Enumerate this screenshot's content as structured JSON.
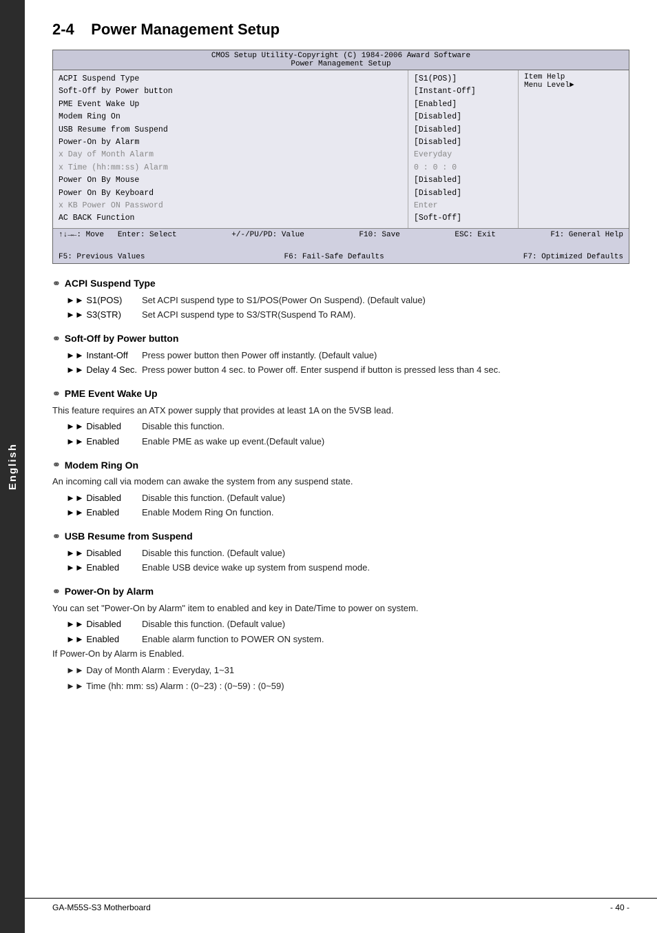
{
  "sidebar": {
    "label": "English"
  },
  "page": {
    "section": "2-4",
    "title": "Power Management Setup"
  },
  "bios": {
    "header1": "CMOS Setup Utility-Copyright (C) 1984-2006 Award Software",
    "header2": "Power Management Setup",
    "rows": [
      {
        "label": "    ACPI Suspend Type",
        "value": "[S1(POS)]",
        "dimmed": false
      },
      {
        "label": "    Soft-Off by Power button",
        "value": "[Instant-Off]",
        "dimmed": false
      },
      {
        "label": "    PME Event Wake Up",
        "value": "[Enabled]",
        "dimmed": false
      },
      {
        "label": "    Modem Ring On",
        "value": "[Disabled]",
        "dimmed": false
      },
      {
        "label": "    USB Resume from Suspend",
        "value": "[Disabled]",
        "dimmed": false
      },
      {
        "label": "    Power-On by Alarm",
        "value": "[Disabled]",
        "dimmed": false
      },
      {
        "label": "  x Day of Month Alarm",
        "value": "Everyday",
        "dimmed": true
      },
      {
        "label": "  x Time (hh:mm:ss) Alarm",
        "value": "0 : 0 : 0",
        "dimmed": true
      },
      {
        "label": "    Power On By Mouse",
        "value": "[Disabled]",
        "dimmed": false
      },
      {
        "label": "    Power On By Keyboard",
        "value": "[Disabled]",
        "dimmed": false
      },
      {
        "label": "  x KB Power ON Password",
        "value": "Enter",
        "dimmed": true
      },
      {
        "label": "    AC BACK Function",
        "value": "[Soft-Off]",
        "dimmed": false
      }
    ],
    "help": {
      "item_help": "Item Help",
      "menu_level": "Menu Level►"
    },
    "footer": {
      "line1_left1": "↑↓→←: Move",
      "line1_left2": "Enter: Select",
      "line1_mid": "+/-/PU/PD: Value",
      "line1_right1": "F10: Save",
      "line1_right2": "ESC: Exit",
      "line1_right3": "F1: General Help",
      "line2_left1": "F5: Previous Values",
      "line2_mid": "F6: Fail-Safe Defaults",
      "line2_right": "F7: Optimized Defaults"
    }
  },
  "sections": [
    {
      "id": "acpi-suspend-type",
      "heading": "ACPI Suspend Type",
      "desc": "",
      "options": [
        {
          "label": "►► S1(POS)",
          "desc": "Set ACPI suspend type to S1/POS(Power On Suspend). (Default value)"
        },
        {
          "label": "►► S3(STR)",
          "desc": "Set ACPI suspend type to S3/STR(Suspend To RAM)."
        }
      ]
    },
    {
      "id": "soft-off",
      "heading": "Soft-Off by Power button",
      "desc": "",
      "options": [
        {
          "label": "►► Instant-Off",
          "desc": "Press power button then Power off instantly. (Default value)"
        },
        {
          "label": "►► Delay 4 Sec.",
          "desc": "Press power button 4 sec. to Power off. Enter suspend if button is pressed less than 4 sec."
        }
      ]
    },
    {
      "id": "pme-event",
      "heading": "PME Event Wake Up",
      "desc": "This feature requires an ATX power supply that provides at least 1A on the 5VSB lead.",
      "options": [
        {
          "label": "►► Disabled",
          "desc": "Disable this function."
        },
        {
          "label": "►► Enabled",
          "desc": "Enable PME as wake up event.(Default value)"
        }
      ]
    },
    {
      "id": "modem-ring",
      "heading": "Modem Ring On",
      "desc": "An incoming call via modem can awake the system from any suspend state.",
      "options": [
        {
          "label": "►► Disabled",
          "desc": "Disable this function. (Default value)"
        },
        {
          "label": "►► Enabled",
          "desc": "Enable Modem Ring On function."
        }
      ]
    },
    {
      "id": "usb-resume",
      "heading": "USB Resume from Suspend",
      "desc": "",
      "options": [
        {
          "label": "►► Disabled",
          "desc": "Disable this function. (Default value)"
        },
        {
          "label": "►► Enabled",
          "desc": "Enable USB device wake up system from suspend mode."
        }
      ]
    },
    {
      "id": "power-on-alarm",
      "heading": "Power-On by Alarm",
      "desc": "You can set \"Power-On by Alarm\" item to enabled and key in Date/Time to power on system.",
      "options": [
        {
          "label": "►► Disabled",
          "desc": "Disable this function. (Default value)"
        },
        {
          "label": "►► Enabled",
          "desc": "Enable alarm function to POWER ON system."
        }
      ],
      "extra": [
        "If Power-On by Alarm is Enabled.",
        "►► Day of Month Alarm :       Everyday, 1~31",
        "►► Time (hh: mm: ss) Alarm :   (0~23) : (0~59) : (0~59)"
      ]
    }
  ],
  "footer": {
    "left": "GA-M55S-S3 Motherboard",
    "right": "- 40 -"
  }
}
